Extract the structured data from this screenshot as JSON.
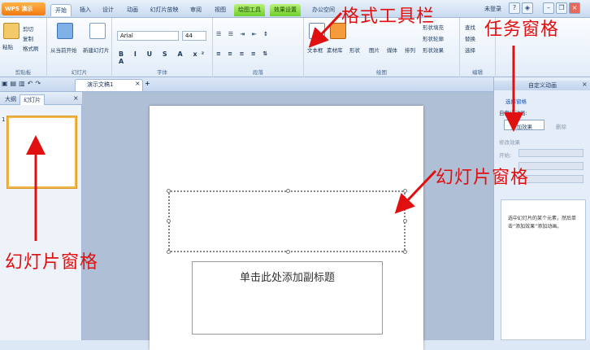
{
  "app": {
    "menu_button": "WPS 演示"
  },
  "tabs": [
    "开始",
    "插入",
    "设计",
    "动画",
    "幻灯片放映",
    "审阅",
    "视图",
    "绘图工具",
    "效果设置",
    "办公空间"
  ],
  "login": "未登录",
  "ribbon": {
    "clipboard": {
      "paste": "粘贴",
      "cut": "剪切",
      "copy": "复制",
      "format_painter": "格式刷",
      "label": "剪贴板"
    },
    "slides": {
      "from_current": "从当前开始",
      "new_slide": "新建幻灯片",
      "label": "幻灯片"
    },
    "font": {
      "name": "Arial",
      "size": "44",
      "label": "字体"
    },
    "paragraph": {
      "label": "段落"
    },
    "drawing": {
      "textbox": "文本框",
      "materials": "素材库",
      "shape": "形状",
      "picture": "图片",
      "media": "媒体",
      "arrange": "排列",
      "shape_fill": "形状填充",
      "shape_outline": "形状轮廓",
      "shape_effect": "形状效果",
      "label": "绘图"
    },
    "editing": {
      "find": "查找",
      "replace": "替换",
      "select": "选择",
      "label": "编辑"
    }
  },
  "doc_tab": "演示文稿1",
  "pane_tabs": {
    "outline": "大纲",
    "slides": "幻灯片"
  },
  "slide_number": "1",
  "slide": {
    "subtitle_placeholder": "单击此处添加副标题"
  },
  "task_pane": {
    "title": "自定义动画",
    "select_pane": "选择窗格",
    "custom_animation": "自定义动画:",
    "add_effect": "添加效果",
    "delete": "删除",
    "modify_effect": "修改效果",
    "start_label": "开始:",
    "hint": "选中幻灯片的某个元素，然后单击“添加效果”添加动画。"
  },
  "annotations": {
    "format_toolbar": "格式工具栏",
    "task_pane": "任务窗格",
    "slide_pane_right": "幻灯片窗格",
    "slide_pane_left": "幻灯片窗格"
  },
  "colors": {
    "annotation": "#e01010",
    "accent": "#f07a12",
    "drawing_tab": "#6fcf2c"
  }
}
